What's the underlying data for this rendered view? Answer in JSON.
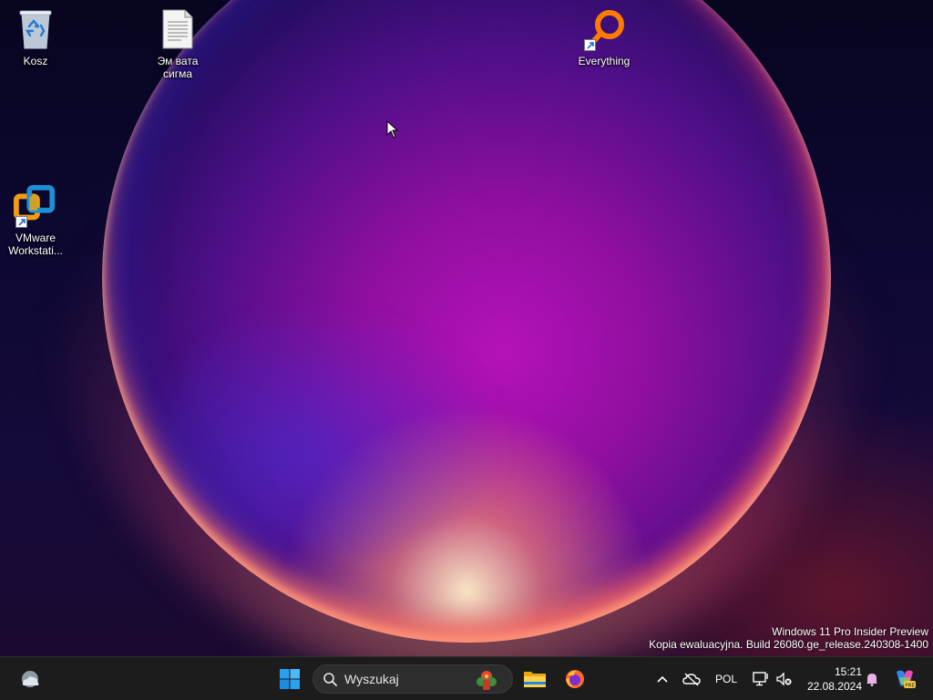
{
  "desktop": {
    "icons": [
      {
        "label": "Kosz",
        "icon": "recycle-bin-icon"
      },
      {
        "label": "Эм вата сигма",
        "icon": "text-document-icon"
      },
      {
        "label": "Everything",
        "icon": "everything-search-icon"
      },
      {
        "label": "VMware Workstati...",
        "icon": "vmware-icon"
      }
    ]
  },
  "watermark": {
    "line1": "Windows 11 Pro Insider Preview",
    "line2": "Kopia ewaluacyjna. Build 26080.ge_release.240308-1400"
  },
  "taskbar": {
    "search_placeholder": "Wyszukaj",
    "language": "POL",
    "time": "15:21",
    "date": "22.08.2024"
  },
  "colors": {
    "taskbar_bg": "#1c1c1c",
    "accent_blue": "#0078d4",
    "everything_orange": "#ff7a00"
  }
}
